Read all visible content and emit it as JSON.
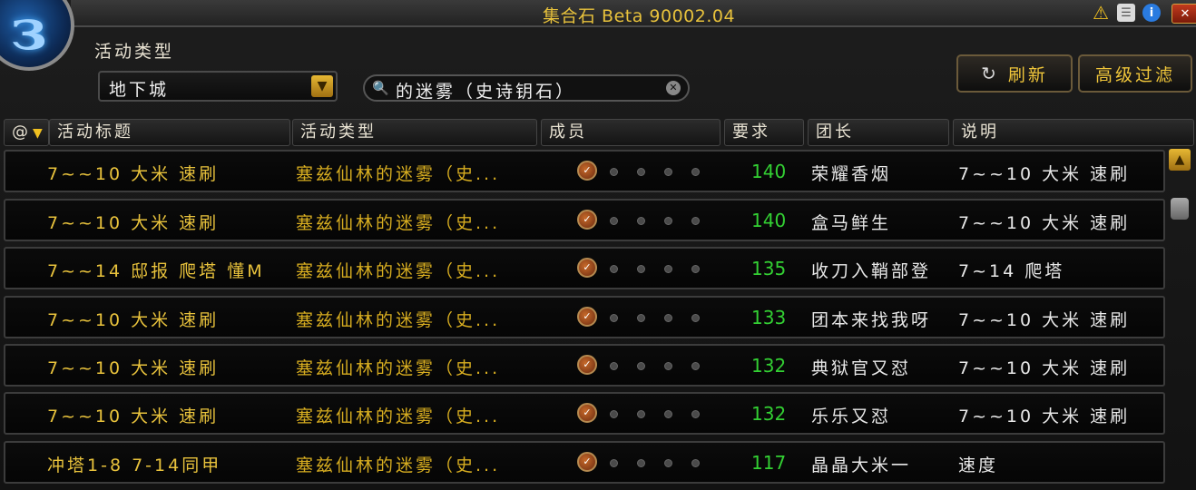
{
  "window": {
    "title": "集合石 Beta 90002.04"
  },
  "filters": {
    "activity_type_label": "活动类型",
    "activity_type_value": "地下城",
    "search_value": "的迷雾（史诗钥石）"
  },
  "toolbar": {
    "refresh_label": "刷新",
    "advanced_filter_label": "高级过滤"
  },
  "columns": [
    "@",
    "活动标题",
    "活动类型",
    "成员",
    "要求",
    "团长",
    "说明"
  ],
  "rows": [
    {
      "title": "7~~10 大米 速刷",
      "type": "塞兹仙林的迷雾（史...",
      "requirement": "140",
      "leader": "荣耀香烟",
      "note": "7~~10 大米 速刷"
    },
    {
      "title": "7~~10 大米 速刷",
      "type": "塞兹仙林的迷雾（史...",
      "requirement": "140",
      "leader": "盒马鲜生",
      "note": "7~~10 大米 速刷"
    },
    {
      "title": "7~~14 邸报 爬塔 懂M",
      "type": "塞兹仙林的迷雾（史...",
      "requirement": "135",
      "leader": "收刀入鞘部登",
      "note": "7~14 爬塔"
    },
    {
      "title": "7~~10 大米 速刷",
      "type": "塞兹仙林的迷雾（史...",
      "requirement": "133",
      "leader": "团本来找我呀",
      "note": "7~~10 大米 速刷"
    },
    {
      "title": "7~~10 大米 速刷",
      "type": "塞兹仙林的迷雾（史...",
      "requirement": "132",
      "leader": "典狱官又怼",
      "note": "7~~10 大米 速刷"
    },
    {
      "title": "7~~10 大米 速刷",
      "type": "塞兹仙林的迷雾（史...",
      "requirement": "132",
      "leader": "乐乐又怼",
      "note": "7~~10 大米 速刷"
    },
    {
      "title": "冲塔1-8 7-14同甲",
      "type": "塞兹仙林的迷雾（史...",
      "requirement": "117",
      "leader": "晶晶大米一",
      "note": "速度"
    }
  ],
  "icons": {
    "logo": "swirl-logo-icon",
    "warning": "warning-icon",
    "document": "document-icon",
    "info": "info-icon",
    "close": "close-icon",
    "dropdown": "chevron-down-icon",
    "search": "search-icon",
    "clear": "clear-icon",
    "refresh": "refresh-icon",
    "leader": "leader-role-icon",
    "member_slot": "empty-slot-icon",
    "scroll_up": "scroll-up-icon"
  },
  "colors": {
    "accent_gold": "#e8c23c",
    "requirement_green": "#33d033",
    "text_white": "#e8e8e8"
  }
}
